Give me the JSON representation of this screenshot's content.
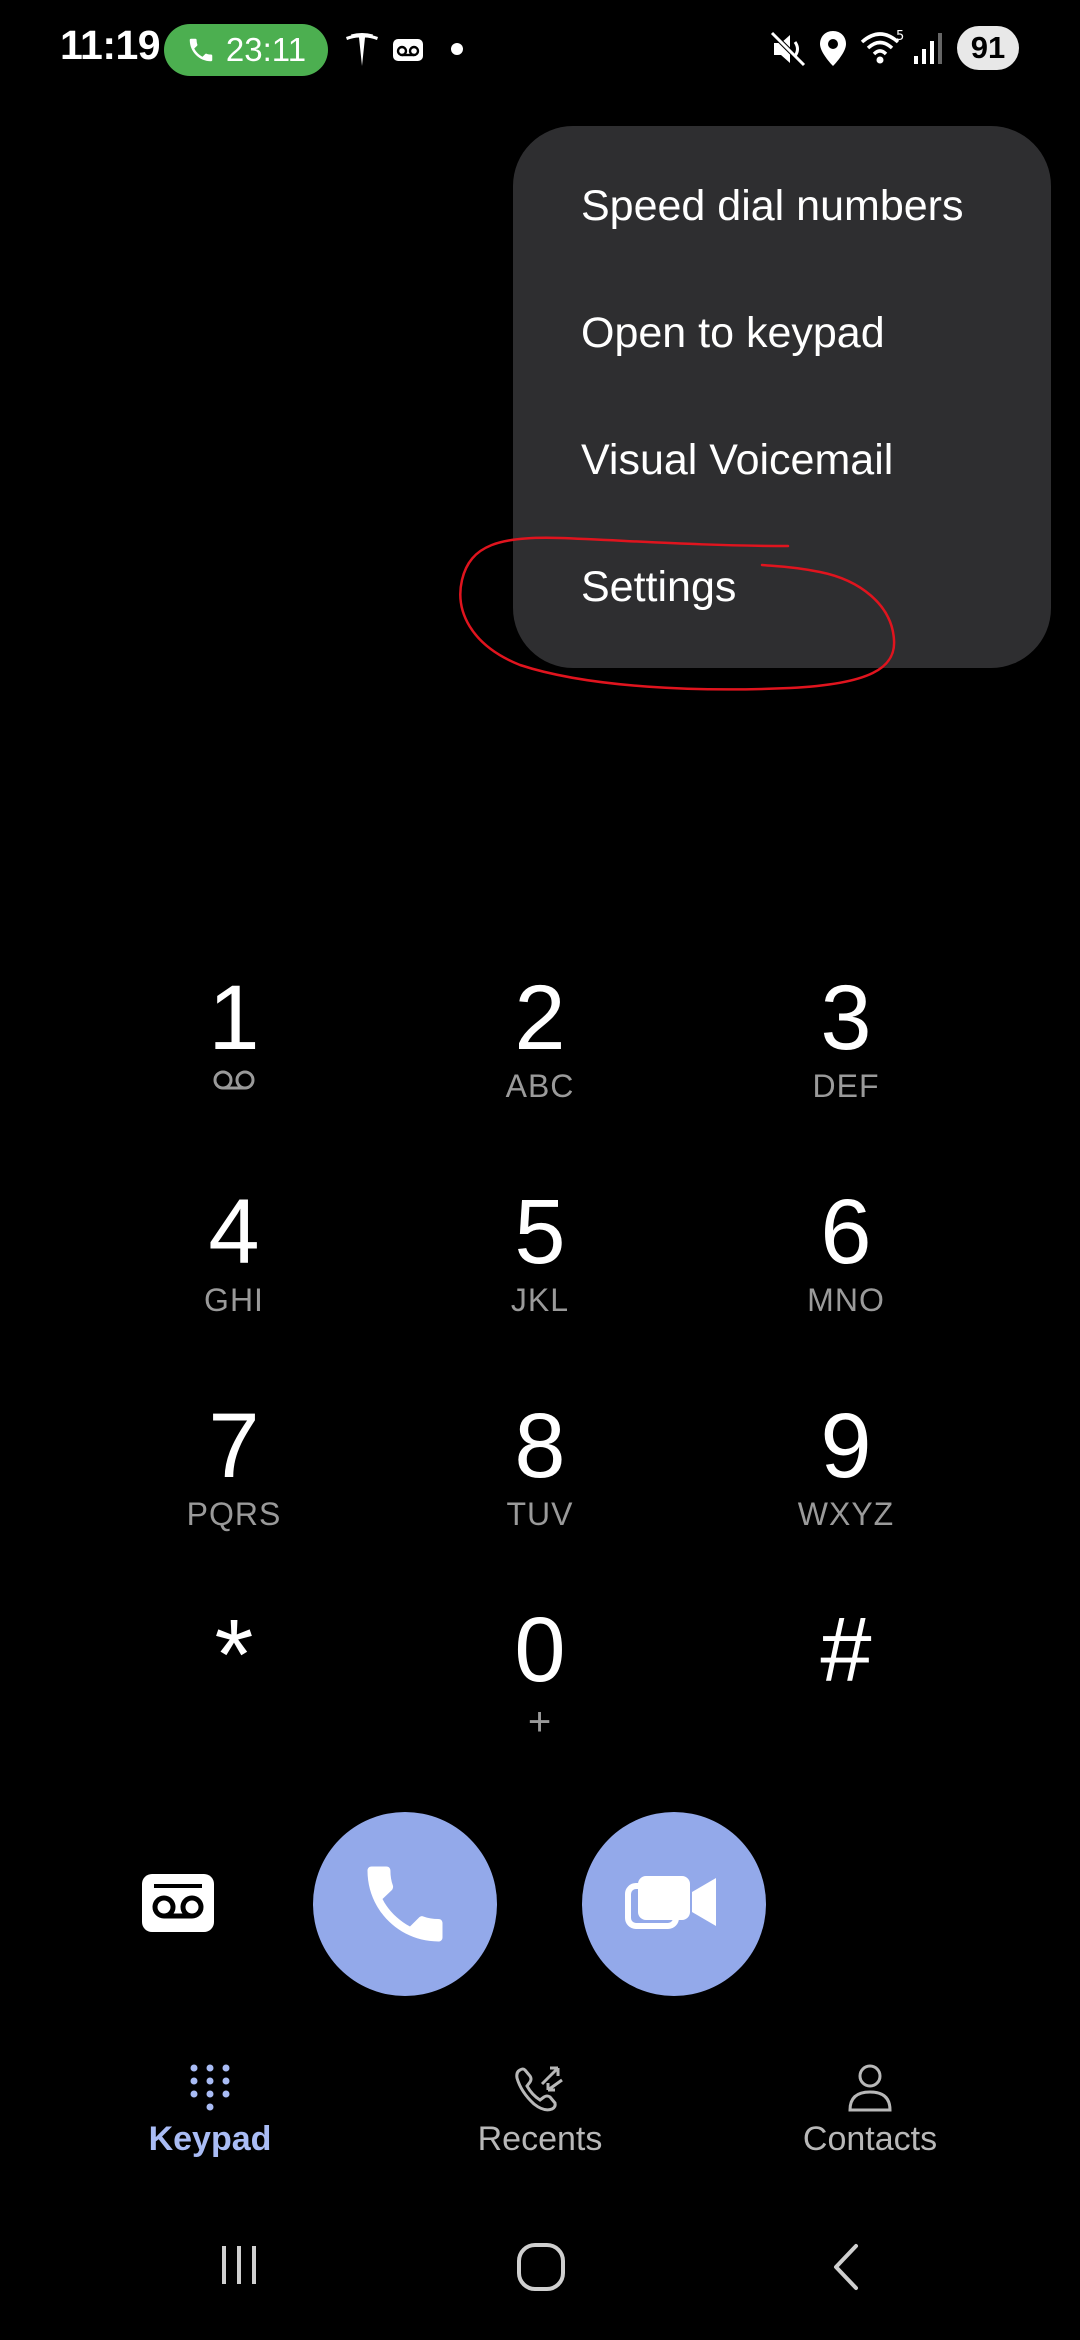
{
  "status_bar": {
    "time": "11:19",
    "call_timer": "23:11",
    "battery": "91",
    "network": "5"
  },
  "menu": {
    "items": [
      {
        "label": "Speed dial numbers"
      },
      {
        "label": "Open to keypad"
      },
      {
        "label": "Visual Voicemail"
      },
      {
        "label": "Settings"
      }
    ]
  },
  "keypad": {
    "keys": [
      {
        "digit": "1",
        "letters": ""
      },
      {
        "digit": "2",
        "letters": "ABC"
      },
      {
        "digit": "3",
        "letters": "DEF"
      },
      {
        "digit": "4",
        "letters": "GHI"
      },
      {
        "digit": "5",
        "letters": "JKL"
      },
      {
        "digit": "6",
        "letters": "MNO"
      },
      {
        "digit": "7",
        "letters": "PQRS"
      },
      {
        "digit": "8",
        "letters": "TUV"
      },
      {
        "digit": "9",
        "letters": "WXYZ"
      },
      {
        "digit": "*",
        "letters": ""
      },
      {
        "digit": "0",
        "letters": "+"
      },
      {
        "digit": "#",
        "letters": ""
      }
    ]
  },
  "tabs": [
    {
      "label": "Keypad",
      "active": true
    },
    {
      "label": "Recents",
      "active": false
    },
    {
      "label": "Contacts",
      "active": false
    }
  ],
  "colors": {
    "accent": "#93a9ea",
    "active_tab": "#a9bcf5",
    "inactive_tab": "#b8b8b8",
    "menu_bg": "#2e2e30",
    "call_pill": "#4caf50",
    "annotation": "#e0141e"
  }
}
